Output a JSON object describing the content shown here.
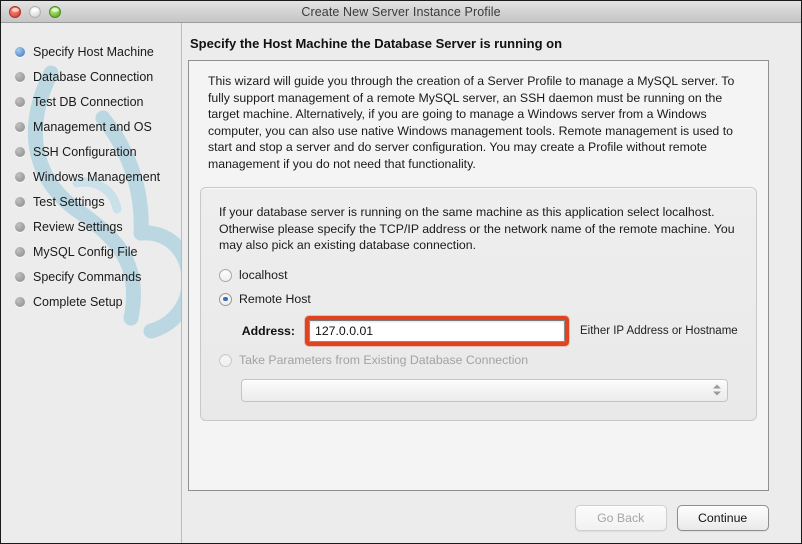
{
  "window": {
    "title": "Create New Server Instance Profile",
    "controls": {
      "close": "close-button",
      "minimize": "minimize-button",
      "maximize": "maximize-button"
    }
  },
  "sidebar": {
    "items": [
      {
        "label": "Specify Host Machine",
        "active": true
      },
      {
        "label": "Database Connection",
        "active": false
      },
      {
        "label": "Test DB Connection",
        "active": false
      },
      {
        "label": "Management and OS",
        "active": false
      },
      {
        "label": "SSH Configuration",
        "active": false
      },
      {
        "label": "Windows Management",
        "active": false
      },
      {
        "label": "Test Settings",
        "active": false
      },
      {
        "label": "Review Settings",
        "active": false
      },
      {
        "label": "MySQL Config File",
        "active": false
      },
      {
        "label": "Specify Commands",
        "active": false
      },
      {
        "label": "Complete Setup",
        "active": false
      }
    ]
  },
  "main": {
    "page_title": "Specify the Host Machine the Database Server is running on",
    "intro_text": "This wizard will guide you through the creation of a Server Profile to manage a MySQL server. To fully support management of a remote MySQL server, an SSH daemon must be running on the target machine. Alternatively, if you are going to manage a Windows server from a Windows computer, you can also use native Windows management tools. Remote management is used to start and stop a server and do server configuration. You may create a Profile without remote management if you do not need that functionality.",
    "panel": {
      "description": "If your database server is running on the same machine as this application select localhost. Otherwise please specify the TCP/IP address or the network name of the remote machine. You may also pick an existing database connection.",
      "options": [
        {
          "label": "localhost",
          "selected": false,
          "disabled": false
        },
        {
          "label": "Remote Host",
          "selected": true,
          "disabled": false
        },
        {
          "label": "Take Parameters from Existing Database Connection",
          "selected": false,
          "disabled": true
        }
      ],
      "address": {
        "label": "Address:",
        "value": "127.0.0.01",
        "placeholder": "",
        "hint": "Either IP Address or Hostname",
        "highlighted": true,
        "highlight_color": "#e0431f"
      },
      "connection_select": {
        "value": "",
        "options": []
      }
    }
  },
  "footer": {
    "go_back_label": "Go Back",
    "continue_label": "Continue",
    "go_back_disabled": true
  },
  "colors": {
    "accent_blue": "#3c6fae",
    "highlight_red": "#e0431f",
    "window_bg": "#ececec",
    "panel_bg": "#f4f4f4",
    "watermark_blue": "#b9d7e2"
  }
}
